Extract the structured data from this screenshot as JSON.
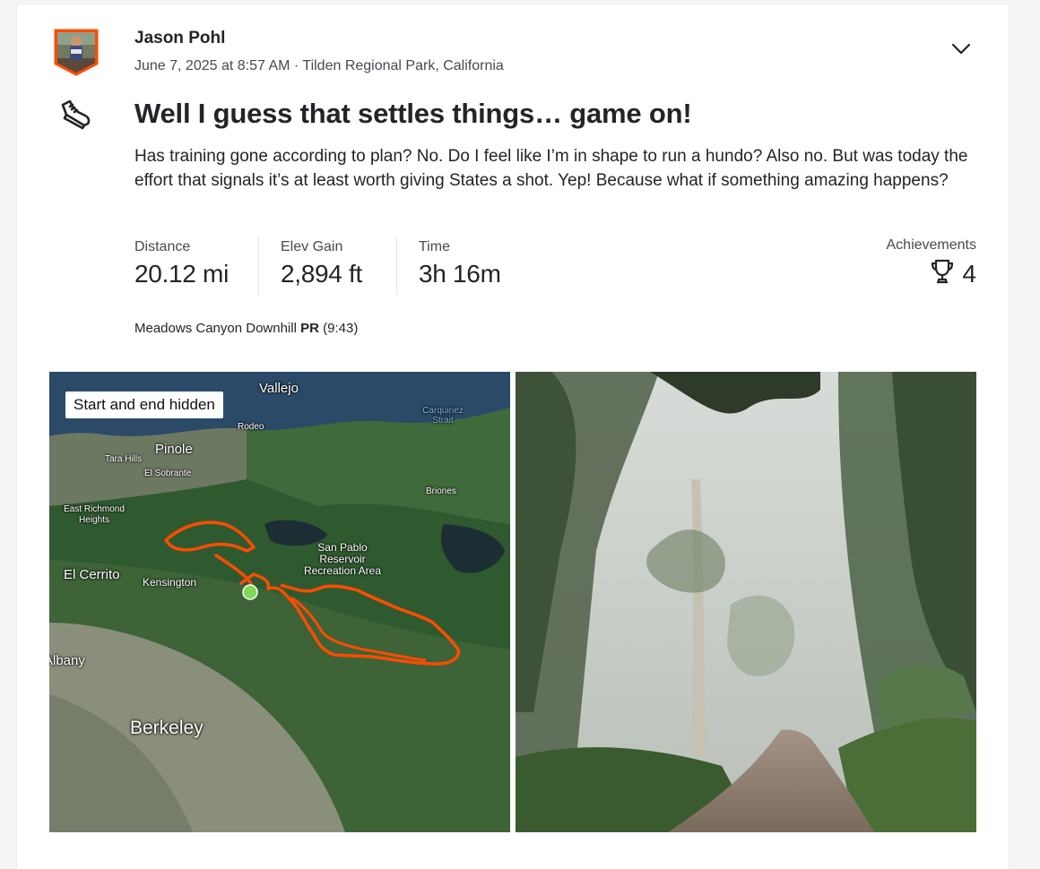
{
  "activity": {
    "athlete_name": "Jason Pohl",
    "date_location": "June 7, 2025 at 8:57 AM · Tilden Regional Park, California",
    "title": "Well I guess that settles things… game on!",
    "description": "Has training gone according to plan? No. Do I feel like I’m in shape to run a hundo? Also no. But was today the effort that signals it’s at least worth giving States a shot. Yep! Because what if something amazing happens?",
    "sport_icon": "running-shoe-icon",
    "menu_icon": "chevron-down-icon"
  },
  "stats": [
    {
      "label": "Distance",
      "value": "20.12 mi"
    },
    {
      "label": "Elev Gain",
      "value": "2,894 ft"
    },
    {
      "label": "Time",
      "value": "3h 16m"
    }
  ],
  "achievements": {
    "label": "Achievements",
    "count": "4",
    "icon": "trophy-icon"
  },
  "segment": {
    "name": "Meadows Canyon Downhill",
    "badge": "PR",
    "time": "(9:43)"
  },
  "map": {
    "badge": "Start and end hidden",
    "route_color": "#fc4c02",
    "places": {
      "vallejo": "Vallejo",
      "carquinez": "Carquinez Strait",
      "rodeo": "Rodeo",
      "pinole": "Pinole",
      "tara_hills": "Tara Hills",
      "el_sobrante": "El Sobrante",
      "briones": "Briones",
      "east_richmond_heights": "East Richmond Heights",
      "san_pablo": "San Pablo Reservoir Recreation Area",
      "el_cerrito": "El Cerrito",
      "kensington": "Kensington",
      "albany": "Albany",
      "berkeley": "Berkeley"
    }
  }
}
